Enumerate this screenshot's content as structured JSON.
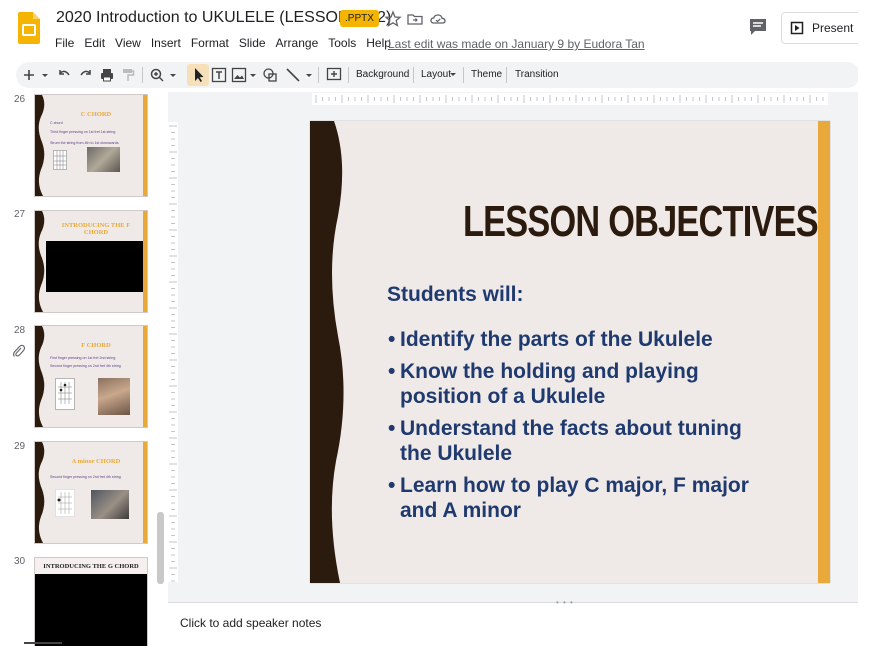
{
  "document": {
    "title": "2020 Introduction to UKULELE (LESSON 1 - 2)",
    "badge": ".PPTX",
    "last_edit": "Last edit was made on January 9 by Eudora Tan"
  },
  "menu": [
    "File",
    "Edit",
    "View",
    "Insert",
    "Format",
    "Slide",
    "Arrange",
    "Tools",
    "Help"
  ],
  "header": {
    "present_label": "Present"
  },
  "toolbar": {
    "background_label": "Background",
    "layout_label": "Layout",
    "theme_label": "Theme",
    "transition_label": "Transition"
  },
  "filmstrip": [
    {
      "number": "26",
      "title": "C CHORD",
      "lines": [
        "C chord",
        "Third finger pressing on 1st fret 1st string",
        "Strum the string from 4th to 1st downwards"
      ]
    },
    {
      "number": "27",
      "title": "INTRODUCING THE F CHORD",
      "lines": []
    },
    {
      "number": "28",
      "title": "F CHORD",
      "lines": [
        "First finger pressing on 1st fret 2nd string",
        "Second finger pressing on 2nd fret 4th string"
      ]
    },
    {
      "number": "29",
      "title": "A minor CHORD",
      "lines": [
        "Second finger pressing on 2nd fret 4th string"
      ]
    },
    {
      "number": "30",
      "title": "INTRODUCING THE G CHORD",
      "lines": []
    }
  ],
  "slide": {
    "title": "LESSON OBJECTIVES",
    "subtitle": "Students will:",
    "bullets": [
      "Identify the parts of the Ukulele",
      "Know the holding and playing position of a Ukulele",
      "Understand the facts about tuning the Ukulele",
      "Learn how to play C major,  F major and A minor"
    ]
  },
  "notes": {
    "placeholder": "Click to add speaker notes"
  },
  "colors": {
    "theme_dark": "#2b1a0e",
    "theme_gold": "#e9a93a",
    "slide_bg": "#efe9e7",
    "text_blue": "#1f3a6e"
  },
  "icons": [
    "slides-logo-icon",
    "star-icon",
    "move-to-folder-icon",
    "cloud-status-icon",
    "comments-icon",
    "present-icon",
    "new-slide-icon",
    "undo-icon",
    "redo-icon",
    "print-icon",
    "paint-format-icon",
    "zoom-icon",
    "select-icon",
    "text-box-icon",
    "image-icon",
    "shape-icon",
    "line-icon",
    "comment-add-icon",
    "attachment-icon"
  ]
}
